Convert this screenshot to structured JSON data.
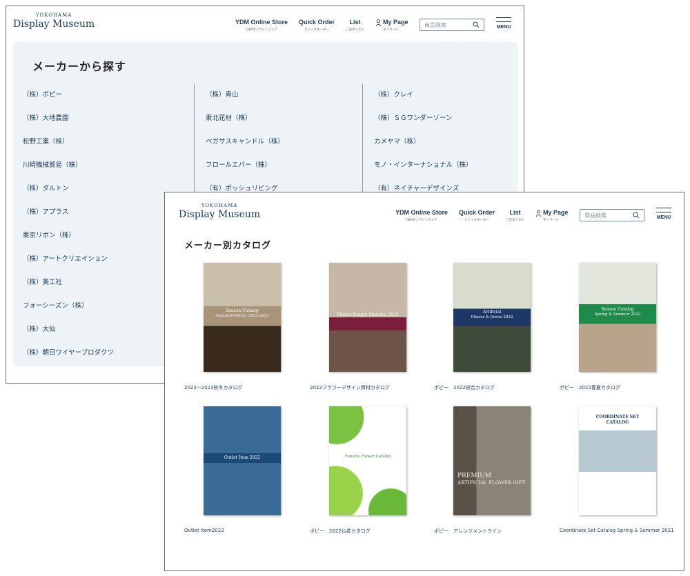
{
  "brand": {
    "logo_small": "YOKOHAMA",
    "logo_main": "Display Museum"
  },
  "header": {
    "nav": [
      {
        "label": "YDM Online Store",
        "sub": "YDMオンラインストア"
      },
      {
        "label": "Quick Order",
        "sub": "クイックオーダー"
      },
      {
        "label": "List",
        "sub": "ご注文リスト"
      }
    ],
    "mypage": {
      "label": "My Page",
      "sub": "マイページ"
    },
    "search_placeholder": "商品検索",
    "menu_label": "MENU"
  },
  "maker_section": {
    "title": "メーカーから探す",
    "columns": [
      [
        "（株）ポピー",
        "（株）大地農園",
        "松野工業（株）",
        "川崎機械貿易（株）",
        "（株）ダルトン",
        "（株）アプラス",
        "東京リボン（株）",
        "（株）アートクリエイション",
        "（株）美工社",
        "フォーシーズン（株）",
        "（株）大仙",
        "（株）朝日ワイヤープロダクツ"
      ],
      [
        "（株）青山",
        "東北花材（株）",
        "ペガサスキャンドル（株）",
        "フロールエバー（株）",
        "（有）ポッシュリビング"
      ],
      [
        "（株）クレイ",
        "（株）ＳＧワンダーゾーン",
        "カメヤマ（株）",
        "モノ・インターナショナル（株）",
        "（有）ネイチャーデザインズ"
      ]
    ]
  },
  "catalog_section": {
    "title": "メーカー別カタログ",
    "items": [
      {
        "label": "2022〜2023秋冬カタログ",
        "cover_line1": "Season Catalog",
        "cover_line2": "Autumn&Winter 2022-2023",
        "band_color": "#a89478"
      },
      {
        "label": "2022フラワーデザイン資材カタログ",
        "cover_line1": "Flower Design Material 2022",
        "cover_line2": "",
        "band_color": "#7a1f3a"
      },
      {
        "label": "ポピー　2022総合カタログ",
        "cover_line1": "Artificial",
        "cover_line2": "Flower & Green 2022",
        "band_color": "#1d3766"
      },
      {
        "label": "ポピー　2022春夏カタログ",
        "cover_line1": "Season Catalog",
        "cover_line2": "Spring & Summer 2022",
        "band_color": "#1f8a4a"
      },
      {
        "label": "Outlet Item2022",
        "cover_line1": "Outlet Item 2022",
        "cover_line2": "",
        "band_color": "#1c4a78"
      },
      {
        "label": "ポピー　2022仏花カタログ",
        "cover_line1": "Funeral Flower Catalog",
        "cover_line2": "",
        "band_color": "#ffffff"
      },
      {
        "label": "ポピー　アレンジメントライン",
        "cover_line1": "PREMIUM",
        "cover_line2": "ARTIFICIAL FLOWER GIFT",
        "band_color": "#4a4a4a"
      },
      {
        "label": "Coordinate Set Catalog Spring & Summer 2021",
        "cover_line1": "COORDINATE SET",
        "cover_line2": "CATALOG",
        "band_color": "#ffffff"
      }
    ]
  }
}
